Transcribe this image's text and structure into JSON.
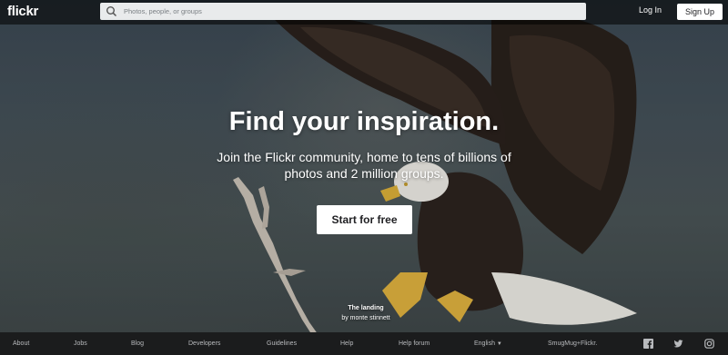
{
  "header": {
    "logo": "flickr",
    "search_placeholder": "Photos, people, or groups",
    "login_label": "Log In",
    "signup_label": "Sign Up"
  },
  "hero": {
    "headline": "Find your inspiration.",
    "subtitle": "Join the Flickr community, home to tens of billions of photos and 2 million groups.",
    "cta_label": "Start for free",
    "credit_title": "The landing",
    "credit_author": "by monte stinnett"
  },
  "footer": {
    "links": [
      "About",
      "Jobs",
      "Blog",
      "Developers",
      "Guidelines",
      "Help",
      "Help forum"
    ],
    "language": "English",
    "smugmug": "SmugMug+Flickr.",
    "social_icons": [
      "facebook-icon",
      "twitter-icon",
      "instagram-icon"
    ]
  },
  "colors": {
    "topbar": "#000000",
    "footer": "#1b1c1d",
    "button_bg": "#ffffff",
    "text_light": "#ffffff"
  }
}
